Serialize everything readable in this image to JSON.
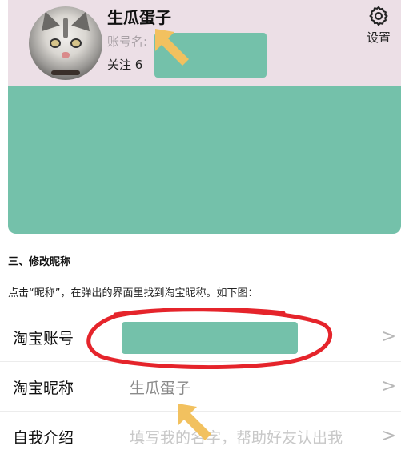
{
  "profile": {
    "nickname": "生瓜蛋子",
    "account_label": "账号名:",
    "follow_text": "关注 6",
    "settings_label": "设置",
    "card_color": "#74c1aa",
    "header_color": "#ecdfe6"
  },
  "article": {
    "section_title": "三、修改昵称",
    "instruction": "点击“昵称”，在弹出的界面里找到淘宝昵称。如下图："
  },
  "settings_rows": [
    {
      "label": "淘宝账号",
      "value": ""
    },
    {
      "label": "淘宝昵称",
      "value": "生瓜蛋子"
    },
    {
      "label": "自我介绍",
      "value": "填写我的名字，帮助好友认出我"
    }
  ],
  "icons": {
    "settings": "gear-icon",
    "chevron": "chevron-right-icon",
    "pointer": "yellow-arrow-icon"
  },
  "colors": {
    "arrow": "#f2c15f",
    "ring": "#e5242b",
    "mask": "#74c1aa"
  },
  "chevron_glyph": ">"
}
